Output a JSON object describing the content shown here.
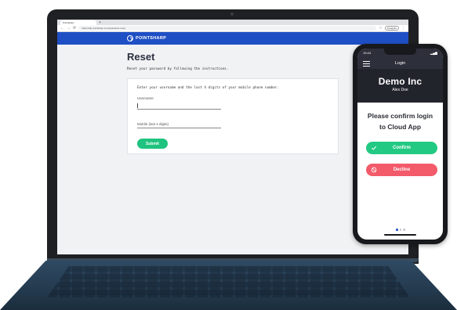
{
  "browser": {
    "tab_title": "Pointsharp",
    "new_tab_glyph": "+",
    "url": "https://idp.pointsharp.com/password-reset",
    "profile_label": "Incognito"
  },
  "app": {
    "brand": "POINTSHARP",
    "title": "Reset",
    "subtitle": "Reset your password by following the instructions.",
    "instructions": "Enter your username and the last 4 digits of your mobile phone number.",
    "username_label": "Username",
    "mobile_label": "Mobile (last 4 digits)",
    "submit_label": "Submit",
    "accent_color": "#1f4fc4",
    "submit_color": "#1fc37f"
  },
  "phone": {
    "time": "15:43",
    "signal": "▂▄▆",
    "nav_title": "Login",
    "company": "Demo Inc",
    "user": "Alex Doe",
    "prompt_line1": "Please confirm login",
    "prompt_line2": "to Cloud App",
    "confirm_label": "Confirm",
    "decline_label": "Decline",
    "confirm_color": "#22c983",
    "decline_color": "#f35a6a"
  }
}
